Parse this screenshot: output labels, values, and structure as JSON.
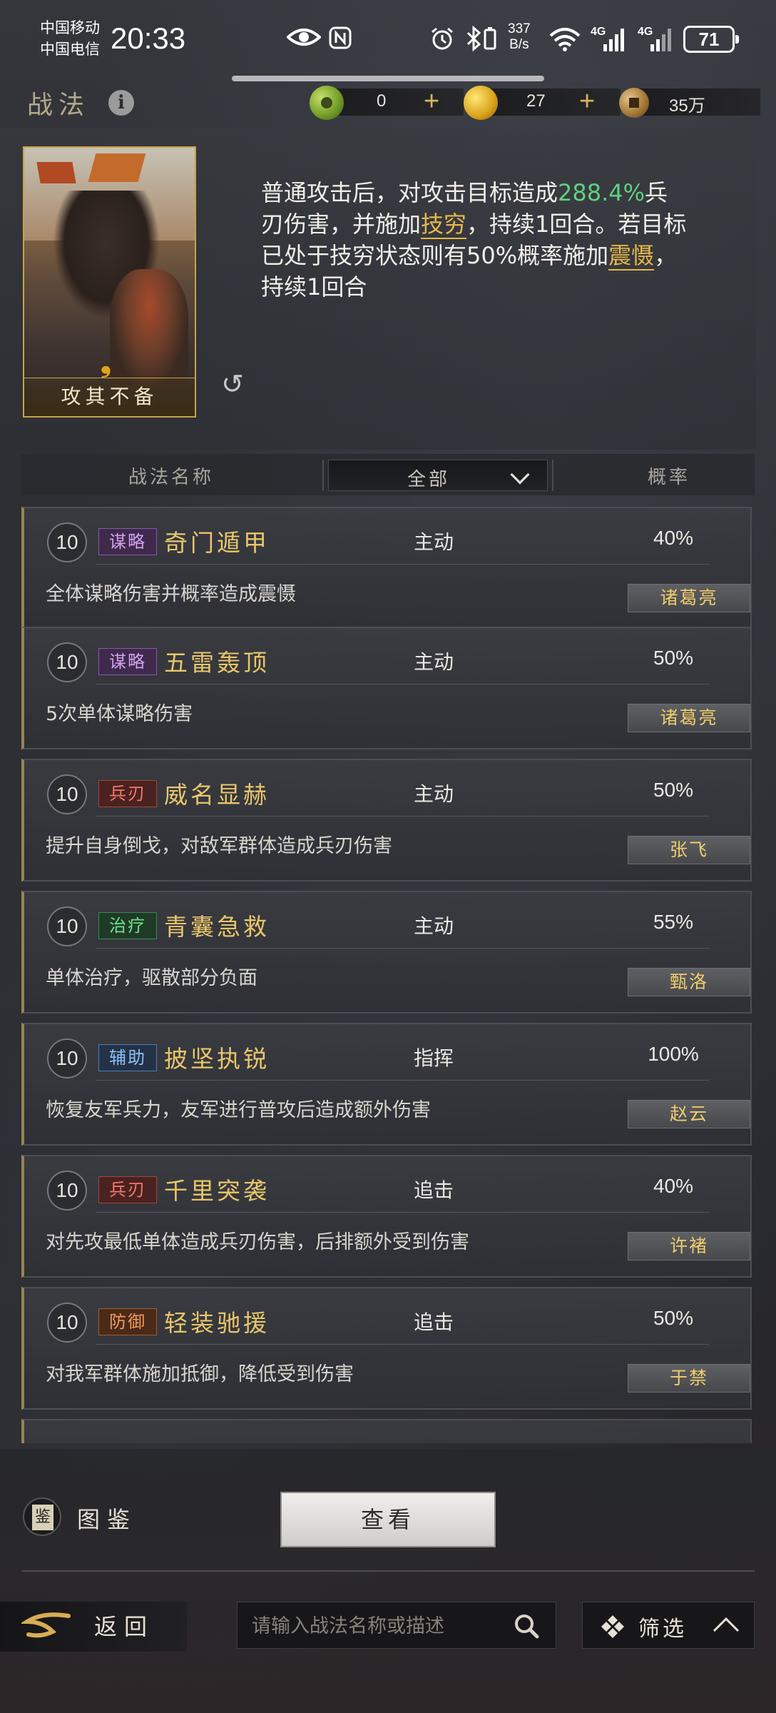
{
  "status_bar": {
    "carrier1": "中国移动",
    "carrier2": "中国电信",
    "time": "20:33",
    "net_speed_value": "337",
    "net_speed_unit": "B/s",
    "sig1": "4G",
    "sig2": "4G",
    "battery": "71"
  },
  "header": {
    "title": "战法",
    "jade": "0",
    "gold": "27",
    "copper": "35万"
  },
  "skill": {
    "card_name": "攻其不备",
    "desc_part1": "普通攻击后，对攻击目标造成",
    "desc_pct": "288.4%",
    "desc_part2": "兵刃伤害，并施加",
    "desc_kw1": "技穷",
    "desc_part3": "，持续1回合。若目标已处于技穷状态则有50%概率施加",
    "desc_kw2": "震慑",
    "desc_part4": "，持续1回合"
  },
  "columns": {
    "name": "战法名称",
    "filter": "全部",
    "rate": "概率"
  },
  "items": [
    {
      "level": "10",
      "tag": "谋略",
      "tag_color": "purple",
      "name": "奇门遁甲",
      "type": "主动",
      "rate": "40%",
      "desc": "全体谋略伤害并概率造成震慑",
      "general": "诸葛亮"
    },
    {
      "level": "10",
      "tag": "谋略",
      "tag_color": "purple",
      "name": "五雷轰顶",
      "type": "主动",
      "rate": "50%",
      "desc": "5次单体谋略伤害",
      "general": "诸葛亮"
    },
    {
      "level": "10",
      "tag": "兵刃",
      "tag_color": "red",
      "name": "威名显赫",
      "type": "主动",
      "rate": "50%",
      "desc": "提升自身倒戈，对敌军群体造成兵刃伤害",
      "general": "张飞"
    },
    {
      "level": "10",
      "tag": "治疗",
      "tag_color": "green",
      "name": "青囊急救",
      "type": "主动",
      "rate": "55%",
      "desc": "单体治疗，驱散部分负面",
      "general": "甄洛"
    },
    {
      "level": "10",
      "tag": "辅助",
      "tag_color": "blue",
      "name": "披坚执锐",
      "type": "指挥",
      "rate": "100%",
      "desc": "恢复友军兵力，友军进行普攻后造成额外伤害",
      "general": "赵云"
    },
    {
      "level": "10",
      "tag": "兵刃",
      "tag_color": "red",
      "name": "千里突袭",
      "type": "追击",
      "rate": "40%",
      "desc": "对先攻最低单体造成兵刃伤害，后排额外受到伤害",
      "general": "许褚"
    },
    {
      "level": "10",
      "tag": "防御",
      "tag_color": "orange",
      "name": "轻装驰援",
      "type": "追击",
      "rate": "50%",
      "desc": "对我军群体施加抵御，降低受到伤害",
      "general": "于禁"
    }
  ],
  "bottom": {
    "tujian": "图鉴",
    "view": "查看",
    "back": "返回",
    "search_placeholder": "请输入战法名称或描述",
    "filter": "筛选"
  }
}
